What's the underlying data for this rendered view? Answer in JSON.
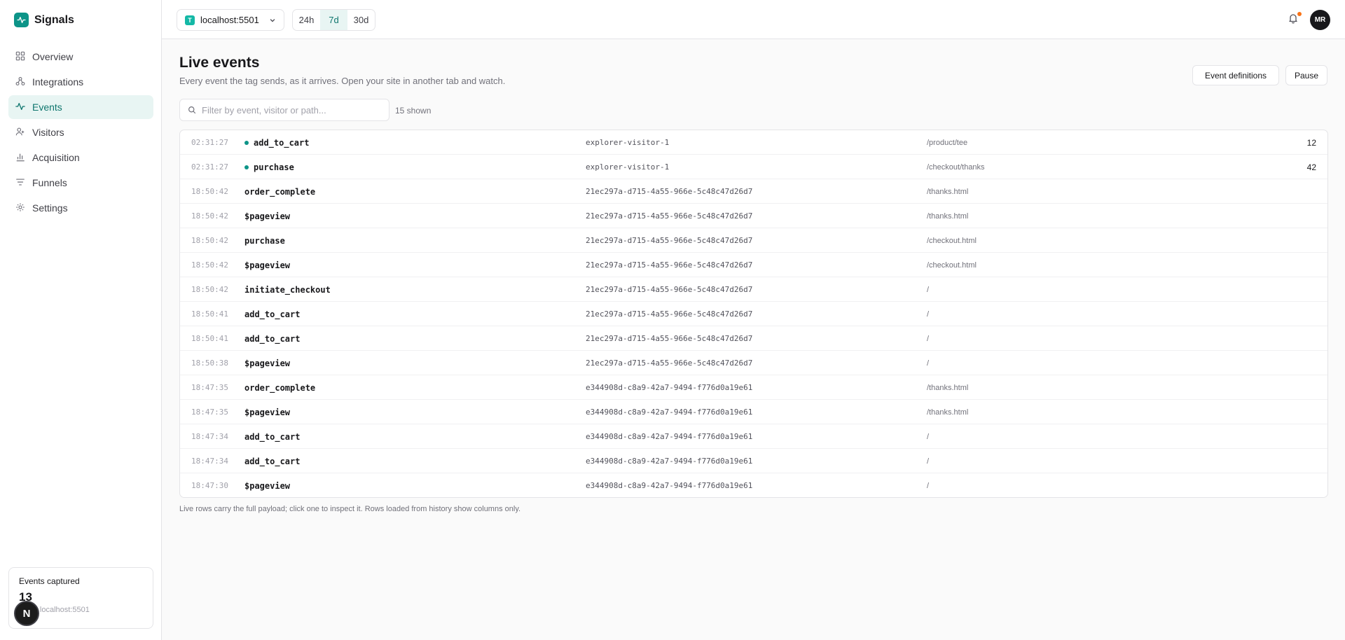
{
  "brand": {
    "name": "Signals"
  },
  "nav": [
    {
      "label": "Overview",
      "icon": "grid-icon",
      "active": false
    },
    {
      "label": "Integrations",
      "icon": "integrations-icon",
      "active": false
    },
    {
      "label": "Events",
      "icon": "activity-icon",
      "active": true
    },
    {
      "label": "Visitors",
      "icon": "users-icon",
      "active": false
    },
    {
      "label": "Acquisition",
      "icon": "bar-chart-icon",
      "active": false
    },
    {
      "label": "Funnels",
      "icon": "funnel-icon",
      "active": false
    },
    {
      "label": "Settings",
      "icon": "gear-icon",
      "active": false
    }
  ],
  "topbar": {
    "site_badge": "T",
    "site": "localhost:5501",
    "ranges": [
      "24h",
      "7d",
      "30d"
    ],
    "active_range": "7d",
    "avatar": "MR"
  },
  "page": {
    "title": "Live events",
    "subtitle": "Every event the tag sends, as it arrives. Open your site in another tab and watch.",
    "defs_button": "Event definitions",
    "pause_button": "Pause",
    "filter_placeholder": "Filter by event, visitor or path...",
    "shown": "15 shown",
    "footnote": "Live rows carry the full payload; click one to inspect it. Rows loaded from history show columns only."
  },
  "events": [
    {
      "time": "02:31:27",
      "event": "add_to_cart",
      "visitor": "explorer-visitor-1",
      "path": "/product/tee",
      "value": "12",
      "live": true
    },
    {
      "time": "02:31:27",
      "event": "purchase",
      "visitor": "explorer-visitor-1",
      "path": "/checkout/thanks",
      "value": "42",
      "live": true
    },
    {
      "time": "18:50:42",
      "event": "order_complete",
      "visitor": "21ec297a-d715-4a55-966e-5c48c47d26d7",
      "path": "/thanks.html",
      "value": "",
      "live": false
    },
    {
      "time": "18:50:42",
      "event": "$pageview",
      "visitor": "21ec297a-d715-4a55-966e-5c48c47d26d7",
      "path": "/thanks.html",
      "value": "",
      "live": false
    },
    {
      "time": "18:50:42",
      "event": "purchase",
      "visitor": "21ec297a-d715-4a55-966e-5c48c47d26d7",
      "path": "/checkout.html",
      "value": "",
      "live": false
    },
    {
      "time": "18:50:42",
      "event": "$pageview",
      "visitor": "21ec297a-d715-4a55-966e-5c48c47d26d7",
      "path": "/checkout.html",
      "value": "",
      "live": false
    },
    {
      "time": "18:50:42",
      "event": "initiate_checkout",
      "visitor": "21ec297a-d715-4a55-966e-5c48c47d26d7",
      "path": "/",
      "value": "",
      "live": false
    },
    {
      "time": "18:50:41",
      "event": "add_to_cart",
      "visitor": "21ec297a-d715-4a55-966e-5c48c47d26d7",
      "path": "/",
      "value": "",
      "live": false
    },
    {
      "time": "18:50:41",
      "event": "add_to_cart",
      "visitor": "21ec297a-d715-4a55-966e-5c48c47d26d7",
      "path": "/",
      "value": "",
      "live": false
    },
    {
      "time": "18:50:38",
      "event": "$pageview",
      "visitor": "21ec297a-d715-4a55-966e-5c48c47d26d7",
      "path": "/",
      "value": "",
      "live": false
    },
    {
      "time": "18:47:35",
      "event": "order_complete",
      "visitor": "e344908d-c8a9-42a7-9494-f776d0a19e61",
      "path": "/thanks.html",
      "value": "",
      "live": false
    },
    {
      "time": "18:47:35",
      "event": "$pageview",
      "visitor": "e344908d-c8a9-42a7-9494-f776d0a19e61",
      "path": "/thanks.html",
      "value": "",
      "live": false
    },
    {
      "time": "18:47:34",
      "event": "add_to_cart",
      "visitor": "e344908d-c8a9-42a7-9494-f776d0a19e61",
      "path": "/",
      "value": "",
      "live": false
    },
    {
      "time": "18:47:34",
      "event": "add_to_cart",
      "visitor": "e344908d-c8a9-42a7-9494-f776d0a19e61",
      "path": "/",
      "value": "",
      "live": false
    },
    {
      "time": "18:47:30",
      "event": "$pageview",
      "visitor": "e344908d-c8a9-42a7-9494-f776d0a19e61",
      "path": "/",
      "value": "",
      "live": false
    }
  ],
  "captured": {
    "title": "Events captured",
    "count": "13",
    "sub": "d · localhost:5501"
  },
  "next_badge": "N",
  "colors": {
    "accent": "#0d9488",
    "accent_bg": "#e8f5f3",
    "notification": "#f97316"
  }
}
